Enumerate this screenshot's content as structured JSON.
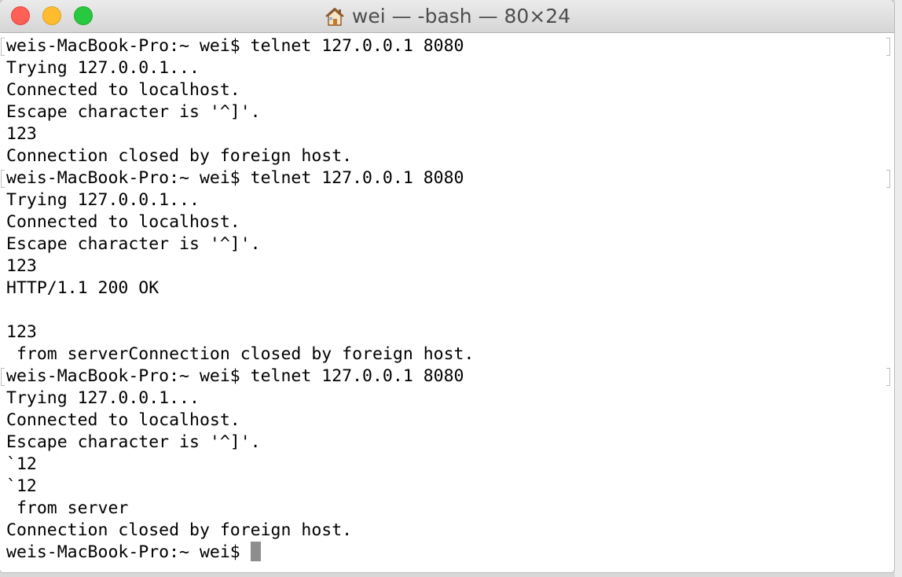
{
  "window": {
    "title": "wei — -bash — 80×24",
    "title_icon": "home-icon"
  },
  "colors": {
    "close": "#fe5f57",
    "minimize": "#febc2e",
    "zoom": "#28c840",
    "terminal_bg": "#ffffff",
    "terminal_fg": "#000000",
    "cursor": "#8e8e8e"
  },
  "terminal": {
    "lines": [
      {
        "text": "weis-MacBook-Pro:~ wei$ telnet 127.0.0.1 8080",
        "mark": true
      },
      {
        "text": "Trying 127.0.0.1...",
        "mark": false
      },
      {
        "text": "Connected to localhost.",
        "mark": false
      },
      {
        "text": "Escape character is '^]'.",
        "mark": false
      },
      {
        "text": "123",
        "mark": false
      },
      {
        "text": "Connection closed by foreign host.",
        "mark": false
      },
      {
        "text": "weis-MacBook-Pro:~ wei$ telnet 127.0.0.1 8080",
        "mark": true
      },
      {
        "text": "Trying 127.0.0.1...",
        "mark": false
      },
      {
        "text": "Connected to localhost.",
        "mark": false
      },
      {
        "text": "Escape character is '^]'.",
        "mark": false
      },
      {
        "text": "123",
        "mark": false
      },
      {
        "text": "HTTP/1.1 200 OK",
        "mark": false
      },
      {
        "text": "",
        "mark": false
      },
      {
        "text": "123",
        "mark": false
      },
      {
        "text": " from serverConnection closed by foreign host.",
        "mark": false
      },
      {
        "text": "weis-MacBook-Pro:~ wei$ telnet 127.0.0.1 8080",
        "mark": true
      },
      {
        "text": "Trying 127.0.0.1...",
        "mark": false
      },
      {
        "text": "Connected to localhost.",
        "mark": false
      },
      {
        "text": "Escape character is '^]'.",
        "mark": false
      },
      {
        "text": "`12",
        "mark": false
      },
      {
        "text": "`12",
        "mark": false
      },
      {
        "text": " from server",
        "mark": false
      },
      {
        "text": "Connection closed by foreign host.",
        "mark": false
      }
    ],
    "prompt": "weis-MacBook-Pro:~ wei$ "
  }
}
